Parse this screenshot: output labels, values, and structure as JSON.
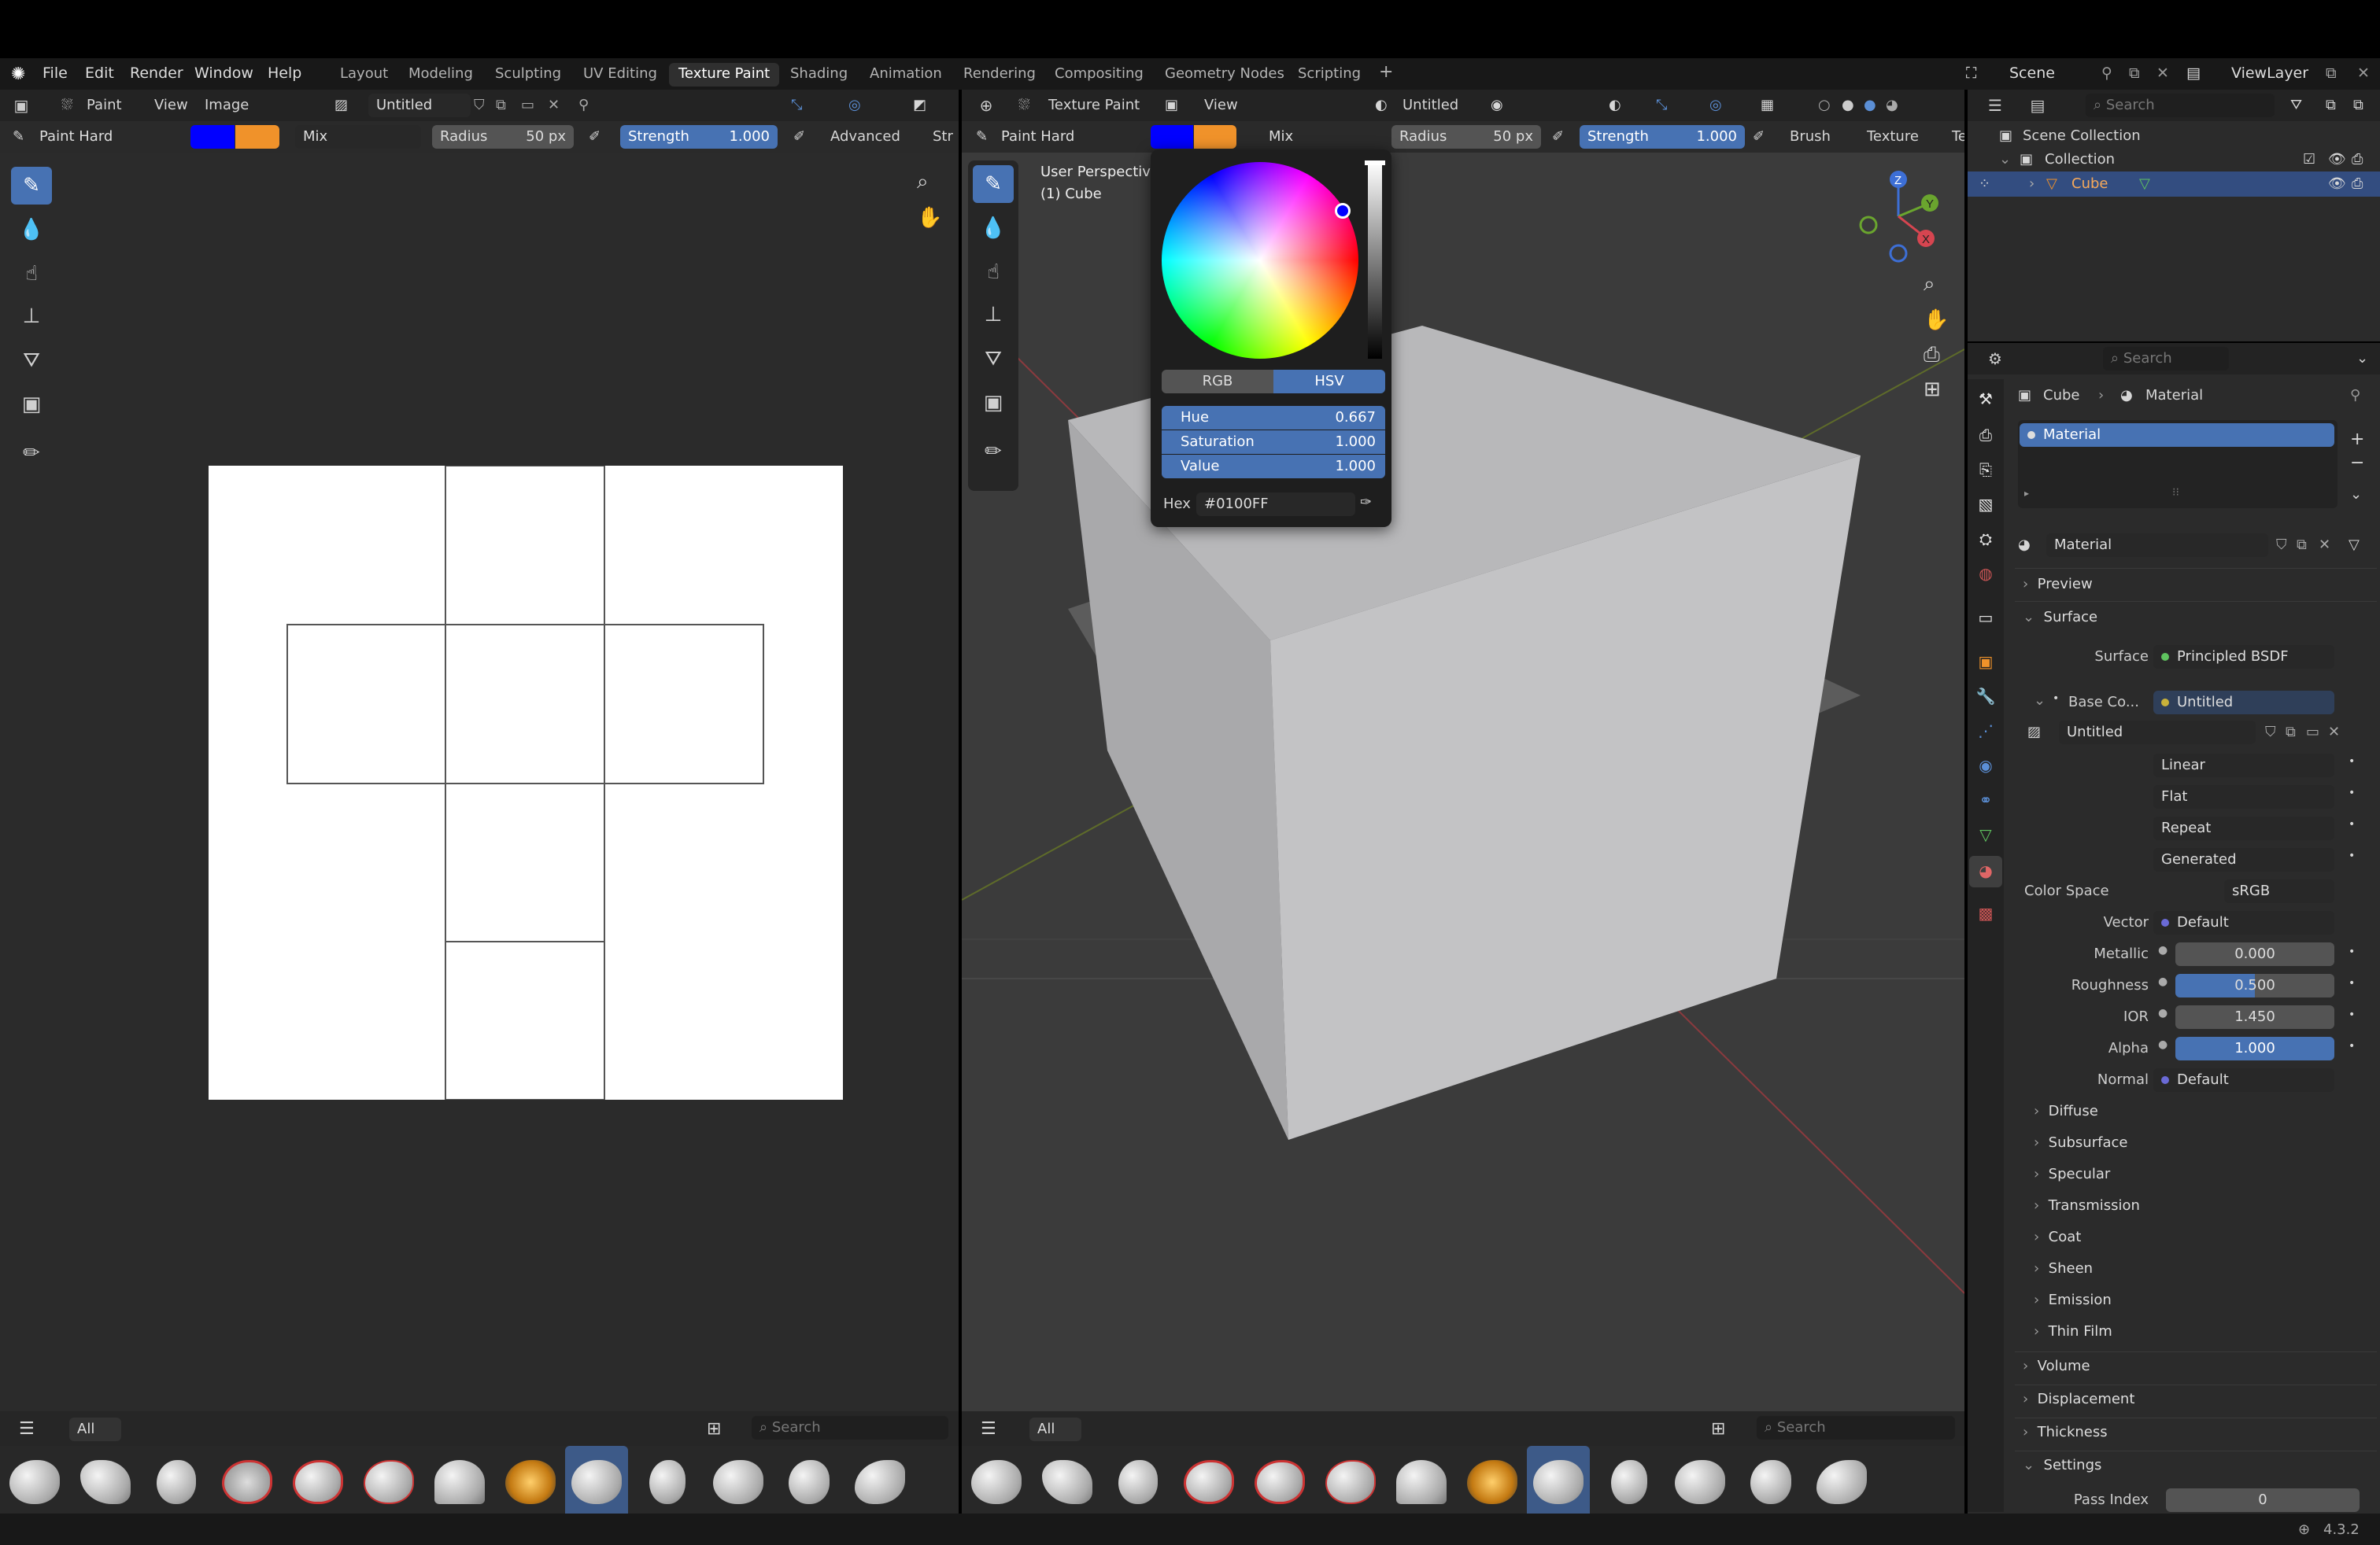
{
  "menubar": {
    "items": [
      "File",
      "Edit",
      "Render",
      "Window",
      "Help"
    ],
    "workspaces": [
      "Layout",
      "Modeling",
      "Sculpting",
      "UV Editing",
      "Texture Paint",
      "Shading",
      "Animation",
      "Rendering",
      "Compositing",
      "Geometry Nodes",
      "Scripting"
    ],
    "active_workspace": "Texture Paint",
    "add": "+",
    "scene": "Scene",
    "view_layer": "ViewLayer"
  },
  "image_editor": {
    "mode": "Paint",
    "menus": [
      "View",
      "Image"
    ],
    "image_name": "Untitled",
    "brush": "Paint Hard",
    "blend": "Mix",
    "radius_label": "Radius",
    "radius_value": "50 px",
    "strength_label": "Strength",
    "strength_value": "1.000",
    "advanced": "Advanced",
    "stroke": "Str",
    "filter_all": "All",
    "search_placeholder": "Search"
  },
  "viewport": {
    "mode": "Texture Paint",
    "menu": "View",
    "slot": "Untitled",
    "brush": "Paint Hard",
    "blend": "Mix",
    "radius_label": "Radius",
    "radius_value": "50 px",
    "strength_label": "Strength",
    "strength_value": "1.000",
    "brush_menu": "Brush",
    "texture_menu": "Texture",
    "tex_short": "Te",
    "view_name": "User Perspective",
    "object_name": "(1) Cube",
    "filter_all": "All",
    "search_placeholder": "Search"
  },
  "color_picker": {
    "mode_rgb": "RGB",
    "mode_hsv": "HSV",
    "active_mode": "HSV",
    "hue_label": "Hue",
    "hue": "0.667",
    "sat_label": "Saturation",
    "sat": "1.000",
    "val_label": "Value",
    "val": "1.000",
    "hex_label": "Hex",
    "hex": "#0100FF",
    "primary_color": "#0100ff",
    "secondary_color": "#f0922a"
  },
  "outliner": {
    "search_placeholder": "Search",
    "root": "Scene Collection",
    "collection": "Collection",
    "object": "Cube"
  },
  "properties": {
    "search_placeholder": "Search",
    "breadcrumb_object": "Cube",
    "breadcrumb_material": "Material",
    "slot": "Material",
    "material_name": "Material",
    "sections": {
      "preview": "Preview",
      "surface": "Surface",
      "volume": "Volume",
      "displacement": "Displacement",
      "thickness": "Thickness",
      "settings": "Settings"
    },
    "surface_label": "Surface",
    "surface_value": "Principled BSDF",
    "base_color_label": "Base Co...",
    "base_color_value": "Untitled",
    "image": "Untitled",
    "interpolation": "Linear",
    "projection": "Flat",
    "extension": "Repeat",
    "source": "Generated",
    "color_space_label": "Color Space",
    "color_space": "sRGB",
    "vector_label": "Vector",
    "vector": "Default",
    "metallic_label": "Metallic",
    "metallic": "0.000",
    "roughness_label": "Roughness",
    "roughness": "0.500",
    "ior_label": "IOR",
    "ior": "1.450",
    "alpha_label": "Alpha",
    "alpha": "1.000",
    "normal_label": "Normal",
    "normal": "Default",
    "subpanels": [
      "Diffuse",
      "Subsurface",
      "Specular",
      "Transmission",
      "Coat",
      "Sheen",
      "Emission",
      "Thin Film"
    ],
    "pass_index_label": "Pass Index",
    "pass_index": "0"
  },
  "status": {
    "version": "4.3.2"
  }
}
